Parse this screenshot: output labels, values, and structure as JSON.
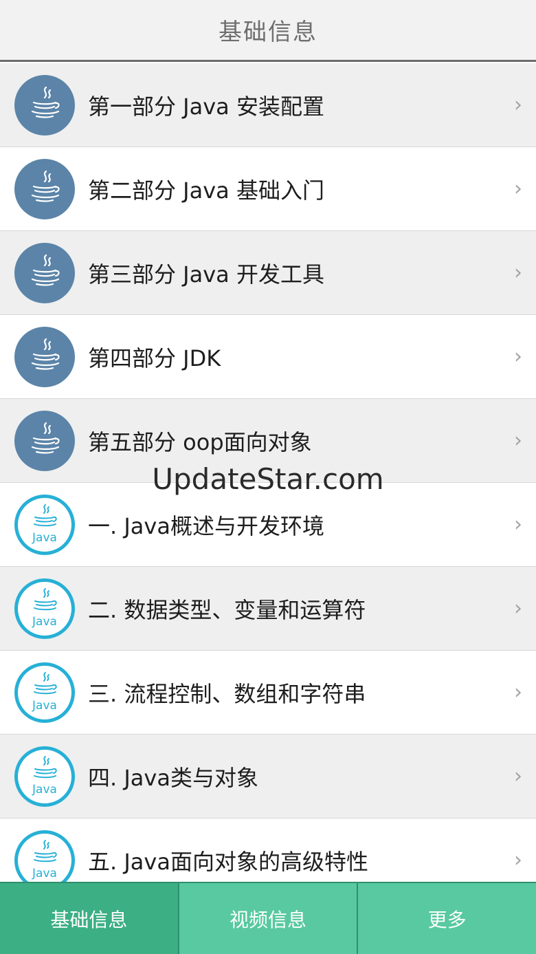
{
  "header": {
    "title": "基础信息"
  },
  "list": {
    "items": [
      {
        "label": "第一部分 Java 安装配置",
        "icon": "java-cup-icon"
      },
      {
        "label": "第二部分 Java 基础入门",
        "icon": "java-cup-icon"
      },
      {
        "label": "第三部分 Java 开发工具",
        "icon": "java-cup-icon"
      },
      {
        "label": "第四部分 JDK",
        "icon": "java-cup-icon"
      },
      {
        "label": "第五部分 oop面向对象",
        "icon": "java-cup-icon"
      },
      {
        "label": "一. Java概述与开发环境",
        "icon": "java-logo-icon"
      },
      {
        "label": "二. 数据类型、变量和运算符",
        "icon": "java-logo-icon"
      },
      {
        "label": "三. 流程控制、数组和字符串",
        "icon": "java-logo-icon"
      },
      {
        "label": "四. Java类与对象",
        "icon": "java-logo-icon"
      },
      {
        "label": "五. Java面向对象的高级特性",
        "icon": "java-logo-icon"
      }
    ],
    "chevron": "›"
  },
  "watermark": "UpdateStar.com",
  "icon_text": "Java",
  "tabs": [
    {
      "label": "基础信息",
      "active": true
    },
    {
      "label": "视频信息",
      "active": false
    },
    {
      "label": "更多",
      "active": false
    }
  ],
  "colors": {
    "tab_active": "#3caf85",
    "tab_inactive": "#58c9a1",
    "icon_dark": "#5b84a8",
    "icon_ring": "#27b0d6"
  }
}
